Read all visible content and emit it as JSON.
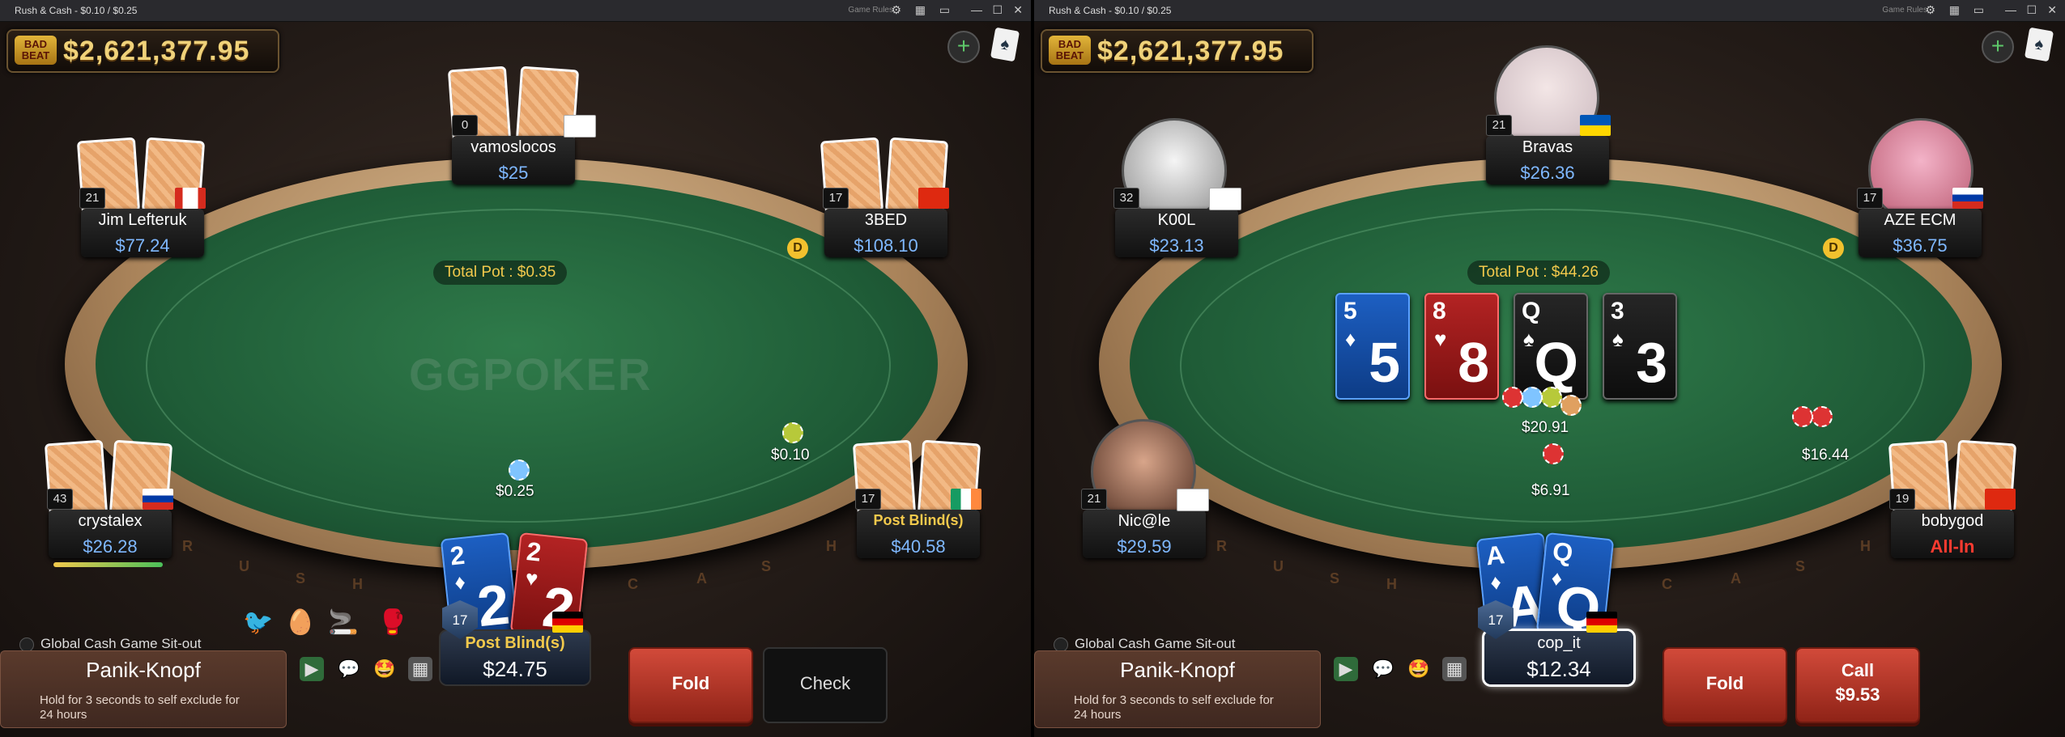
{
  "left": {
    "title": "Rush & Cash - $0.10 / $0.25",
    "game_rules": "Game Rules",
    "jackpot": {
      "badge_line1": "BAD",
      "badge_line2": "BEAT",
      "amount": "$2,621,377.95"
    },
    "total_pot": "Total Pot : $0.35",
    "logo": "GGPOKER",
    "rail_letters": [
      "R",
      "U",
      "S",
      "H",
      "C",
      "A",
      "S",
      "H"
    ],
    "players": {
      "top": {
        "name": "vamoslocos",
        "stack": "$25",
        "level": "0"
      },
      "top_left": {
        "name": "Jim Lefteruk",
        "stack": "$77.24",
        "level": "21"
      },
      "top_right": {
        "name": "3BED",
        "stack": "$108.10",
        "level": "17"
      },
      "bottom_left": {
        "name": "crystalex",
        "stack": "$26.28",
        "level": "43",
        "timer_fraction": 0.9
      },
      "bottom_right": {
        "name": "Post Blind(s)",
        "stack": "$40.58",
        "level": "17"
      }
    },
    "hero": {
      "name": "Post Blind(s)",
      "stack": "$24.75",
      "level": "17",
      "card1_rank": "2",
      "card1_suit": "♦",
      "card2_rank": "2",
      "card2_suit": "♥"
    },
    "bets": {
      "sb": "$0.25",
      "bb": "$0.10"
    },
    "dealer": "D",
    "sitout_label": "Global Cash Game Sit-out",
    "panik": {
      "title": "Panik-Knopf",
      "desc": "Hold for 3 seconds to self exclude for 24 hours"
    },
    "buttons": {
      "fold": "Fold",
      "check": "Check"
    }
  },
  "right": {
    "title": "Rush & Cash - $0.10 / $0.25",
    "game_rules": "Game Rules",
    "jackpot": {
      "badge_line1": "BAD",
      "badge_line2": "BEAT",
      "amount": "$2,621,377.95"
    },
    "total_pot": "Total Pot : $44.26",
    "rail_letters": [
      "R",
      "U",
      "S",
      "H",
      "C",
      "A",
      "S",
      "H"
    ],
    "board": [
      {
        "rank": "5",
        "suit": "♦",
        "color": "blue"
      },
      {
        "rank": "8",
        "suit": "♥",
        "color": "red"
      },
      {
        "rank": "Q",
        "suit": "♠",
        "color": "black"
      },
      {
        "rank": "3",
        "suit": "♠",
        "color": "black"
      }
    ],
    "players": {
      "top": {
        "name": "Bravas",
        "stack": "$26.36",
        "level": "21"
      },
      "top_left": {
        "name": "K00L",
        "stack": "$23.13",
        "level": "32"
      },
      "top_right": {
        "name": "AZE ECM",
        "stack": "$36.75",
        "level": "17"
      },
      "bottom_left": {
        "name": "Nic@le",
        "stack": "$29.59",
        "level": "21"
      },
      "bottom_right": {
        "name": "bobygod",
        "stack": "All-In",
        "level": "19"
      }
    },
    "hero": {
      "name": "cop_it",
      "stack": "$12.34",
      "level": "17",
      "card1_rank": "A",
      "card1_suit": "♦",
      "card2_rank": "Q",
      "card2_suit": "♦"
    },
    "bets": {
      "pot_chips": "$20.91",
      "bottom": "$6.91",
      "right": "$16.44"
    },
    "dealer": "D",
    "sitout_label": "Global Cash Game Sit-out",
    "panik": {
      "title": "Panik-Knopf",
      "desc": "Hold for 3 seconds to self exclude for 24 hours"
    },
    "buttons": {
      "fold": "Fold",
      "call": "Call",
      "call_amount": "$9.53"
    }
  }
}
